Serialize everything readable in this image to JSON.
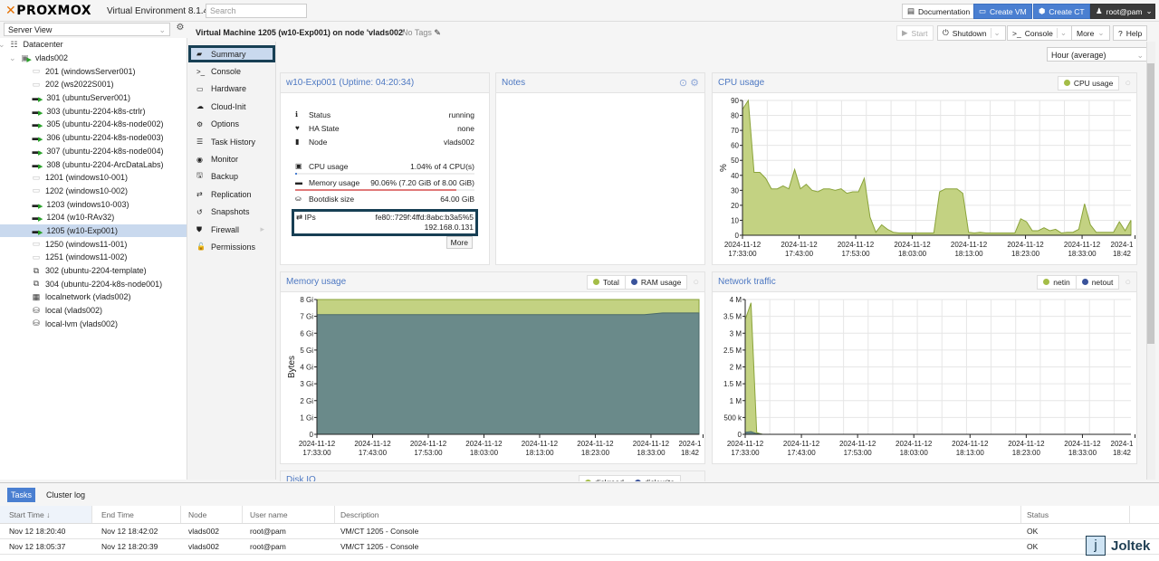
{
  "app": {
    "logo": "PROXMOX",
    "version": "Virtual Environment 8.1.4",
    "search_placeholder": "Search"
  },
  "topbar": {
    "documentation": "Documentation",
    "create_vm": "Create VM",
    "create_ct": "Create CT",
    "user": "root@pam"
  },
  "left": {
    "view": "Server View",
    "tree": [
      {
        "label": "Datacenter",
        "type": "datacenter"
      },
      {
        "label": "vlads002",
        "type": "node"
      },
      {
        "label": "201 (windowsServer001)",
        "type": "vm-stopped"
      },
      {
        "label": "202 (ws2022S001)",
        "type": "vm-stopped"
      },
      {
        "label": "301 (ubuntuServer001)",
        "type": "vm-running"
      },
      {
        "label": "303 (ubuntu-2204-k8s-ctrlr)",
        "type": "vm-running"
      },
      {
        "label": "305 (ubuntu-2204-k8s-node002)",
        "type": "vm-running"
      },
      {
        "label": "306 (ubuntu-2204-k8s-node003)",
        "type": "vm-running"
      },
      {
        "label": "307 (ubuntu-2204-k8s-node004)",
        "type": "vm-running"
      },
      {
        "label": "308 (ubuntu-2204-ArcDataLabs)",
        "type": "vm-running"
      },
      {
        "label": "1201 (windows10-001)",
        "type": "vm-stopped"
      },
      {
        "label": "1202 (windows10-002)",
        "type": "vm-stopped"
      },
      {
        "label": "1203 (windows10-003)",
        "type": "vm-running"
      },
      {
        "label": "1204 (w10-RAv32)",
        "type": "vm-running"
      },
      {
        "label": "1205 (w10-Exp001)",
        "type": "vm-running",
        "selected": true
      },
      {
        "label": "1250 (windows11-001)",
        "type": "vm-stopped"
      },
      {
        "label": "1251 (windows11-002)",
        "type": "vm-stopped"
      },
      {
        "label": "302 (ubuntu-2204-template)",
        "type": "template"
      },
      {
        "label": "304 (ubuntu-2204-k8s-node001)",
        "type": "template"
      },
      {
        "label": "localnetwork (vlads002)",
        "type": "network"
      },
      {
        "label": "local (vlads002)",
        "type": "storage"
      },
      {
        "label": "local-lvm (vlads002)",
        "type": "storage"
      }
    ]
  },
  "header": {
    "title": "Virtual Machine 1205 (w10-Exp001) on node 'vlads002'",
    "tags": "No Tags",
    "start": "Start",
    "shutdown": "Shutdown",
    "console": "Console",
    "more": "More",
    "help": "Help",
    "timeframe": "Hour (average)"
  },
  "menu": [
    {
      "label": "Summary",
      "icon": "book",
      "selected": true
    },
    {
      "label": "Console",
      "icon": ">_"
    },
    {
      "label": "Hardware",
      "icon": "monitor"
    },
    {
      "label": "Cloud-Init",
      "icon": "cloud"
    },
    {
      "label": "Options",
      "icon": "gear"
    },
    {
      "label": "Task History",
      "icon": "list"
    },
    {
      "label": "Monitor",
      "icon": "eye"
    },
    {
      "label": "Backup",
      "icon": "floppy"
    },
    {
      "label": "Replication",
      "icon": "retweet"
    },
    {
      "label": "Snapshots",
      "icon": "history"
    },
    {
      "label": "Firewall",
      "icon": "shield"
    },
    {
      "label": "Permissions",
      "icon": "unlock"
    }
  ],
  "status_panel": {
    "title": "w10-Exp001 (Uptime: 04:20:34)",
    "rows": [
      {
        "key": "Status",
        "value": "running"
      },
      {
        "key": "HA State",
        "value": "none"
      },
      {
        "key": "Node",
        "value": "vlads002"
      }
    ],
    "cpu": {
      "key": "CPU usage",
      "value": "1.04% of 4 CPU(s)",
      "fraction": 0.0104
    },
    "memory": {
      "key": "Memory usage",
      "value": "90.06% (7.20 GiB of 8.00 GiB)",
      "fraction": 0.9006
    },
    "bootdisk": {
      "key": "Bootdisk size",
      "value": "64.00 GiB"
    },
    "ips_label": "IPs",
    "ips": [
      "fe80::729f:4ffd:8abc:b3a5%5",
      "192.168.0.131"
    ],
    "more": "More"
  },
  "notes": {
    "title": "Notes"
  },
  "disk_io": {
    "title": "Disk IO",
    "legend": [
      "diskread",
      "diskwrite"
    ]
  },
  "colors": {
    "green": "#a4bd47",
    "green_fill": "#c3d282",
    "blue": "#3a539b",
    "mem_fill": "#6a8a8a",
    "accent": "#4a7fd1"
  },
  "chart_data": [
    {
      "type": "area",
      "title": "CPU usage",
      "ylabel": "%",
      "ylim": [
        0,
        90
      ],
      "yticks": [
        "0",
        "10",
        "20",
        "30",
        "40",
        "50",
        "60",
        "70",
        "80",
        "90"
      ],
      "xticks": [
        "2024-11-12\n17:33:00",
        "2024-11-12\n17:43:00",
        "2024-11-12\n17:53:00",
        "2024-11-12\n18:03:00",
        "2024-11-12\n18:13:00",
        "2024-11-12\n18:23:00",
        "2024-11-12\n18:33:00",
        "2024-1\n18:42"
      ],
      "legend": [
        "CPU usage"
      ],
      "series": [
        {
          "name": "CPU usage",
          "values": [
            84,
            90,
            42,
            42,
            38,
            31,
            31,
            33,
            31,
            44,
            31,
            34,
            30,
            29,
            31,
            31,
            30,
            31,
            28,
            29,
            29,
            38,
            12,
            2,
            7,
            4,
            2,
            1.5,
            1.5,
            1.5,
            1.5,
            1.5,
            1.5,
            1.5,
            29,
            31,
            31,
            31,
            28,
            2,
            1.5,
            2,
            1.5,
            1.5,
            1.5,
            1.5,
            1.5,
            1.5,
            11,
            9,
            3,
            3,
            5,
            3,
            4,
            1.5,
            2,
            2,
            4,
            21,
            7,
            2,
            2,
            2,
            2,
            9,
            3,
            10
          ]
        }
      ]
    },
    {
      "type": "area",
      "title": "Memory usage",
      "ylabel": "Bytes",
      "ylim": [
        0,
        8
      ],
      "yticks": [
        "0",
        "1 Gi",
        "2 Gi",
        "3 Gi",
        "4 Gi",
        "5 Gi",
        "6 Gi",
        "7 Gi",
        "8 Gi"
      ],
      "xticks": [
        "2024-11-12\n17:33:00",
        "2024-11-12\n17:43:00",
        "2024-11-12\n17:53:00",
        "2024-11-12\n18:03:00",
        "2024-11-12\n18:13:00",
        "2024-11-12\n18:23:00",
        "2024-11-12\n18:33:00",
        "2024-1\n18:42"
      ],
      "legend": [
        "Total",
        "RAM usage"
      ],
      "series": [
        {
          "name": "Total",
          "values": [
            8,
            8,
            8,
            8,
            8,
            8,
            8,
            8,
            8,
            8,
            8,
            8,
            8,
            8,
            8,
            8,
            8,
            8,
            8,
            8,
            8,
            8
          ]
        },
        {
          "name": "RAM usage",
          "values": [
            7.1,
            7.1,
            7.1,
            7.1,
            7.1,
            7.1,
            7.1,
            7.1,
            7.1,
            7.1,
            7.1,
            7.1,
            7.1,
            7.1,
            7.1,
            7.1,
            7.1,
            7.1,
            7.1,
            7.2,
            7.2,
            7.2
          ]
        }
      ]
    },
    {
      "type": "area",
      "title": "Network traffic",
      "ylabel": "",
      "ylim": [
        0,
        4000000
      ],
      "yticks": [
        "0",
        "500 k",
        "1 M",
        "1.5 M",
        "2 M",
        "2.5 M",
        "3 M",
        "3.5 M",
        "4 M"
      ],
      "xticks": [
        "2024-11-12\n17:33:00",
        "2024-11-12\n17:43:00",
        "2024-11-12\n17:53:00",
        "2024-11-12\n18:03:00",
        "2024-11-12\n18:13:00",
        "2024-11-12\n18:23:00",
        "2024-11-12\n18:33:00",
        "2024-1\n18:42"
      ],
      "legend": [
        "netin",
        "netout"
      ],
      "series": [
        {
          "name": "netin",
          "values": [
            3400000,
            3900000,
            50000,
            0,
            0,
            0,
            0,
            0,
            0,
            0,
            0,
            0,
            0,
            0,
            0,
            0,
            0,
            0,
            0,
            0,
            0,
            0,
            0,
            0,
            0,
            0,
            0,
            0,
            0,
            0,
            0,
            0,
            0,
            0,
            0,
            0,
            0,
            0,
            0,
            0,
            0,
            0,
            0,
            0,
            0,
            0,
            0,
            0,
            0,
            0,
            0,
            0,
            0,
            0,
            0,
            0,
            0,
            0,
            0,
            0,
            0,
            0,
            0,
            0,
            0,
            0,
            0,
            0
          ]
        },
        {
          "name": "netout",
          "values": [
            60000,
            80000,
            20000,
            0,
            0,
            0,
            0,
            0,
            0,
            0,
            0,
            0,
            0,
            0,
            0,
            0,
            0,
            0,
            0,
            0,
            0,
            0,
            0,
            0,
            0,
            0,
            0,
            0,
            0,
            0,
            0,
            0,
            0,
            0,
            0,
            0,
            0,
            0,
            0,
            0,
            0,
            0,
            0,
            0,
            0,
            0,
            0,
            0,
            0,
            0,
            0,
            0,
            0,
            0,
            0,
            0,
            0,
            0,
            0,
            0,
            0,
            0,
            0,
            0,
            0,
            0,
            0,
            0
          ]
        }
      ]
    }
  ],
  "tasks": {
    "tabs": [
      "Tasks",
      "Cluster log"
    ],
    "columns": [
      "Start Time ↓",
      "End Time",
      "Node",
      "User name",
      "Description",
      "Status"
    ],
    "rows": [
      [
        "Nov 12 18:20:40",
        "Nov 12 18:42:02",
        "vlads002",
        "root@pam",
        "VM/CT 1205 - Console",
        "OK"
      ],
      [
        "Nov 12 18:05:37",
        "Nov 12 18:20:39",
        "vlads002",
        "root@pam",
        "VM/CT 1205 - Console",
        "OK"
      ]
    ]
  },
  "watermark": "Joltek"
}
